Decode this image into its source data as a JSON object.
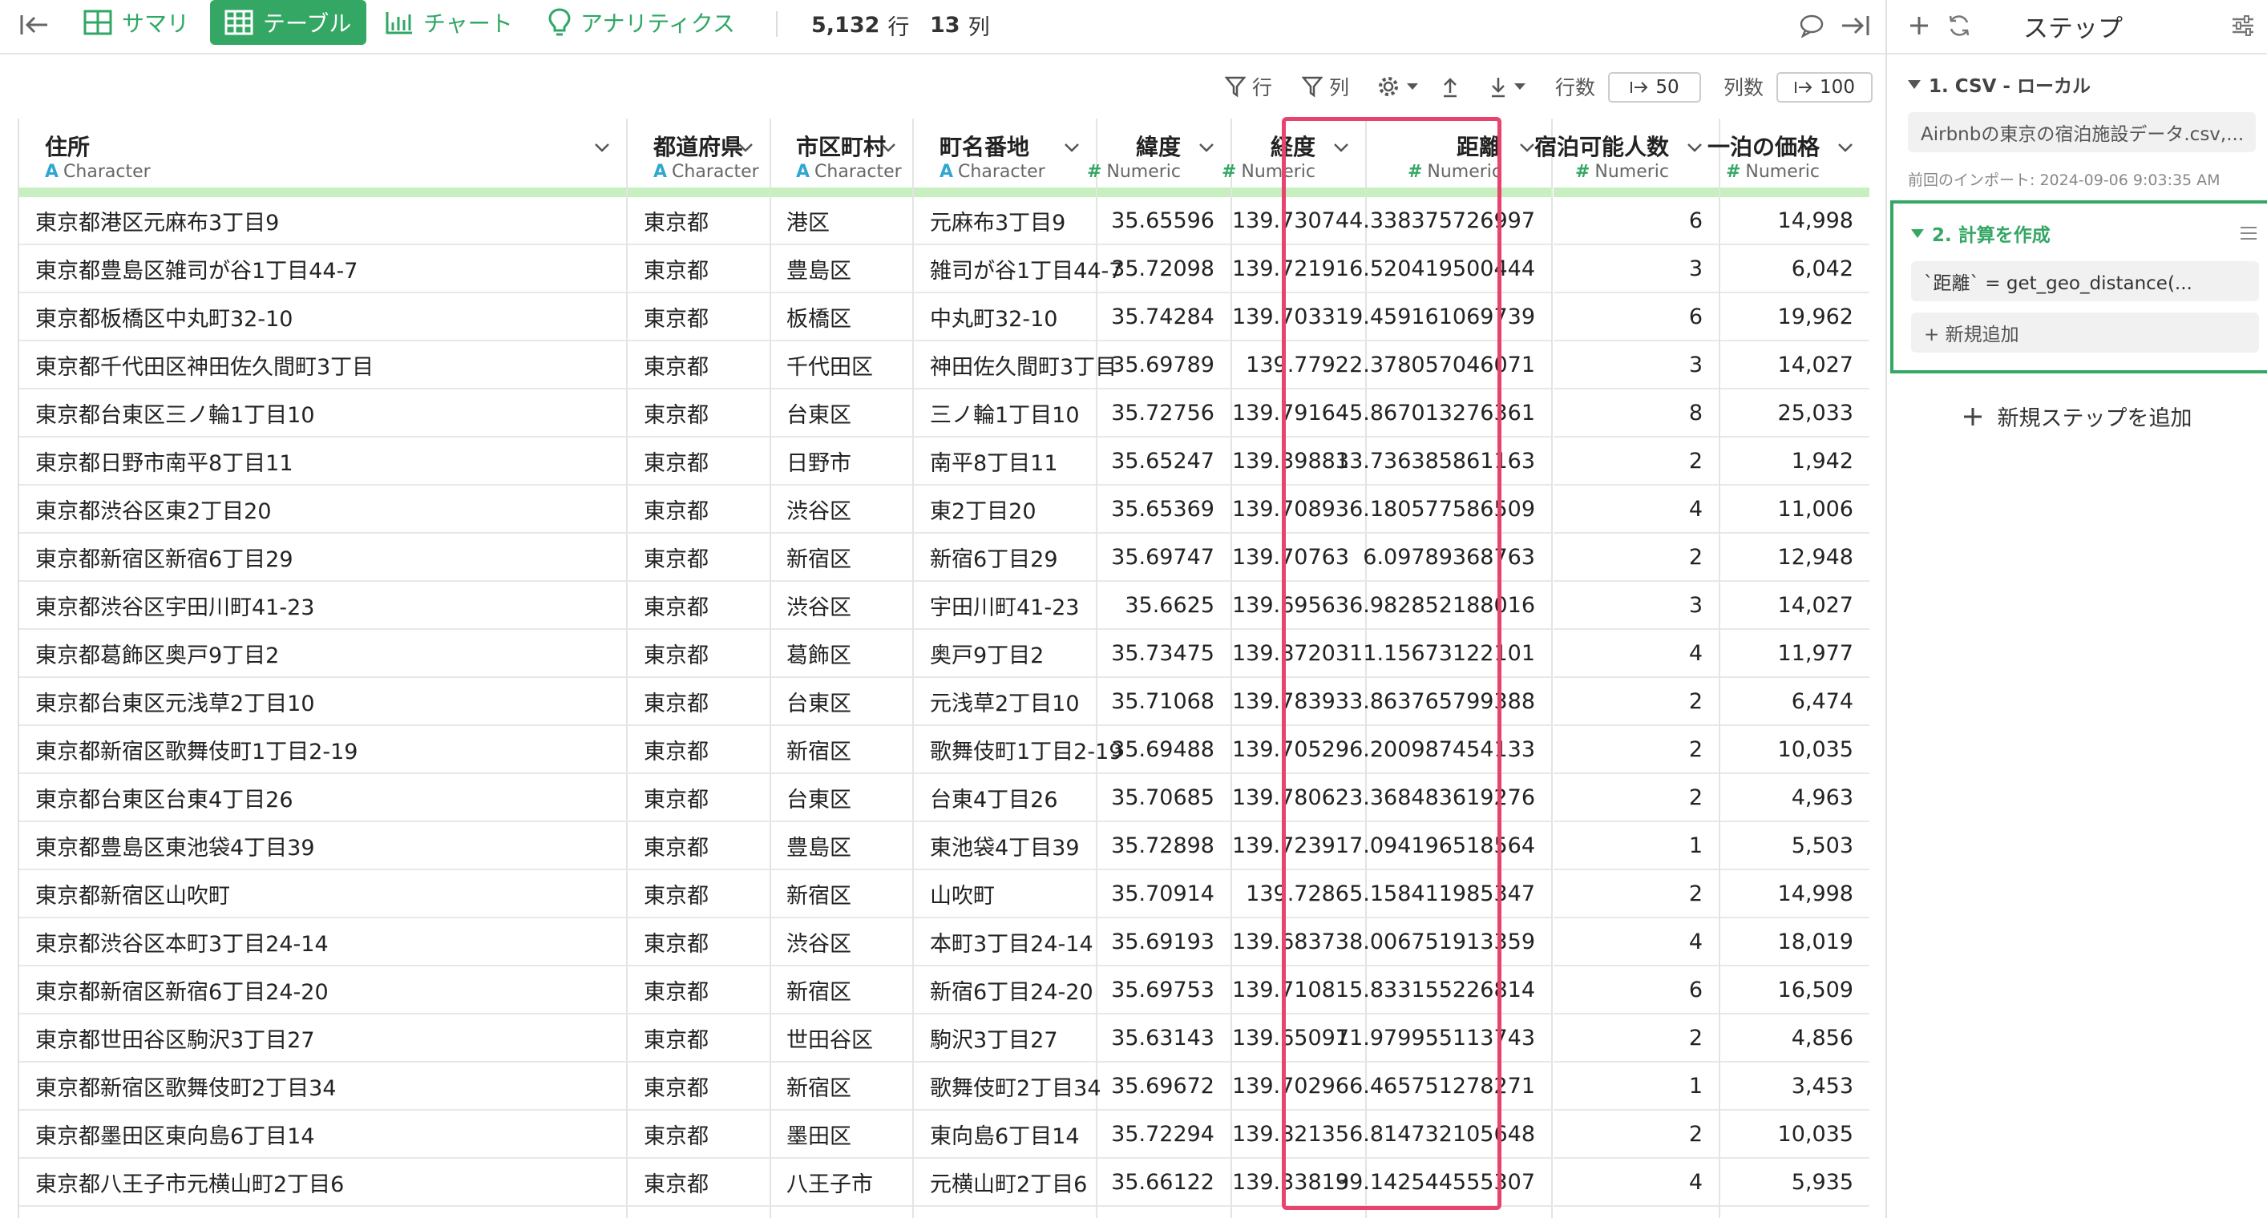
{
  "toolbar": {
    "tabs": [
      {
        "label": "サマリ",
        "icon": "summary-grid-icon",
        "active": false
      },
      {
        "label": "テーブル",
        "icon": "table-icon",
        "active": true
      },
      {
        "label": "チャート",
        "icon": "bar-chart-icon",
        "active": false
      },
      {
        "label": "アナリティクス",
        "icon": "lightbulb-icon",
        "active": false
      }
    ],
    "row_count": "5,132",
    "row_unit": "行",
    "col_count": "13",
    "col_unit": "列"
  },
  "subtoolbar": {
    "row_filter_label": "行",
    "col_filter_label": "列",
    "row_limit_label": "行数",
    "row_limit_value": "50",
    "col_limit_label": "列数",
    "col_limit_value": "100"
  },
  "colors": {
    "accent": "#34a764",
    "highlight": "#e8436e",
    "header_bar": "#c7efbf",
    "char_type": "#2fa7cf"
  },
  "table": {
    "columns": [
      {
        "name": "住所",
        "type": "Character",
        "glyph": "A"
      },
      {
        "name": "都道府県",
        "type": "Character",
        "glyph": "A"
      },
      {
        "name": "市区町村",
        "type": "Character",
        "glyph": "A"
      },
      {
        "name": "町名番地",
        "type": "Character",
        "glyph": "A"
      },
      {
        "name": "緯度",
        "type": "Numeric",
        "glyph": "#"
      },
      {
        "name": "経度",
        "type": "Numeric",
        "glyph": "#"
      },
      {
        "name": "距離",
        "type": "Numeric",
        "glyph": "#"
      },
      {
        "name": "宿泊可能人数",
        "type": "Numeric",
        "glyph": "#"
      },
      {
        "name": "一泊の価格",
        "type": "Numeric",
        "glyph": "#"
      }
    ],
    "rows": [
      [
        "東京都港区元麻布3丁目9",
        "東京都",
        "港区",
        "元麻布3丁目9",
        "35.65596",
        "139.73074",
        "4.338375726997",
        "6",
        "14,998"
      ],
      [
        "東京都豊島区雑司が谷1丁目44-7",
        "東京都",
        "豊島区",
        "雑司が谷1丁目44-7",
        "35.72098",
        "139.72191",
        "6.520419500444",
        "3",
        "6,042"
      ],
      [
        "東京都板橋区中丸町32-10",
        "東京都",
        "板橋区",
        "中丸町32-10",
        "35.74284",
        "139.70331",
        "9.459161069739",
        "6",
        "19,962"
      ],
      [
        "東京都千代田区神田佐久間町3丁目",
        "東京都",
        "千代田区",
        "神田佐久間町3丁目",
        "35.69789",
        "139.7792",
        "2.378057046071",
        "3",
        "14,027"
      ],
      [
        "東京都台東区三ノ輪1丁目10",
        "東京都",
        "台東区",
        "三ノ輪1丁目10",
        "35.72756",
        "139.79164",
        "5.867013276361",
        "8",
        "25,033"
      ],
      [
        "東京都日野市南平8丁目11",
        "東京都",
        "日野市",
        "南平8丁目11",
        "35.65247",
        "139.39881",
        "33.736385861163",
        "2",
        "1,942"
      ],
      [
        "東京都渋谷区東2丁目20",
        "東京都",
        "渋谷区",
        "東2丁目20",
        "35.65369",
        "139.70893",
        "6.180577586509",
        "4",
        "11,006"
      ],
      [
        "東京都新宿区新宿6丁目29",
        "東京都",
        "新宿区",
        "新宿6丁目29",
        "35.69747",
        "139.70763",
        "6.09789368763",
        "2",
        "12,948"
      ],
      [
        "東京都渋谷区宇田川町41-23",
        "東京都",
        "渋谷区",
        "宇田川町41-23",
        "35.6625",
        "139.69563",
        "6.982852188016",
        "3",
        "14,027"
      ],
      [
        "東京都葛飾区奥戸9丁目2",
        "東京都",
        "葛飾区",
        "奥戸9丁目2",
        "35.73475",
        "139.87203",
        "11.15673122101",
        "4",
        "11,977"
      ],
      [
        "東京都台東区元浅草2丁目10",
        "東京都",
        "台東区",
        "元浅草2丁目10",
        "35.71068",
        "139.78393",
        "3.863765799388",
        "2",
        "6,474"
      ],
      [
        "東京都新宿区歌舞伎町1丁目2-19",
        "東京都",
        "新宿区",
        "歌舞伎町1丁目2-19",
        "35.69488",
        "139.70529",
        "6.200987454133",
        "2",
        "10,035"
      ],
      [
        "東京都台東区台東4丁目26",
        "東京都",
        "台東区",
        "台東4丁目26",
        "35.70685",
        "139.78062",
        "3.368483619276",
        "2",
        "4,963"
      ],
      [
        "東京都豊島区東池袋4丁目39",
        "東京都",
        "豊島区",
        "東池袋4丁目39",
        "35.72898",
        "139.72391",
        "7.094196518564",
        "1",
        "5,503"
      ],
      [
        "東京都新宿区山吹町",
        "東京都",
        "新宿区",
        "山吹町",
        "35.70914",
        "139.7286",
        "5.158411985347",
        "2",
        "14,998"
      ],
      [
        "東京都渋谷区本町3丁目24-14",
        "東京都",
        "渋谷区",
        "本町3丁目24-14",
        "35.69193",
        "139.68373",
        "8.006751913359",
        "4",
        "18,019"
      ],
      [
        "東京都新宿区新宿6丁目24-20",
        "東京都",
        "新宿区",
        "新宿6丁目24-20",
        "35.69753",
        "139.71081",
        "5.833155226814",
        "6",
        "16,509"
      ],
      [
        "東京都世田谷区駒沢3丁目27",
        "東京都",
        "世田谷区",
        "駒沢3丁目27",
        "35.63143",
        "139.65097",
        "11.979955113743",
        "2",
        "4,856"
      ],
      [
        "東京都新宿区歌舞伎町2丁目34",
        "東京都",
        "新宿区",
        "歌舞伎町2丁目34",
        "35.69672",
        "139.70296",
        "6.465751278271",
        "1",
        "3,453"
      ],
      [
        "東京都墨田区東向島6丁目14",
        "東京都",
        "墨田区",
        "東向島6丁目14",
        "35.72294",
        "139.82135",
        "6.814732105648",
        "2",
        "10,035"
      ],
      [
        "東京都八王子市元横山町2丁目6",
        "東京都",
        "八王子市",
        "元横山町2丁目6",
        "35.66122",
        "139.33819",
        "39.142544555307",
        "4",
        "5,935"
      ]
    ]
  },
  "panel": {
    "title": "ステップ",
    "step1": {
      "header": "1. CSV - ローカル",
      "file": "Airbnbの東京の宿泊施設データ.csv,...",
      "note": "前回のインポート: 2024-09-06 9:03:35 AM"
    },
    "step2": {
      "header": "2. 計算を作成",
      "formula": "`距離` = get_geo_distance(...",
      "add_label": "+ 新規追加"
    },
    "add_step_label": "新規ステップを追加"
  }
}
